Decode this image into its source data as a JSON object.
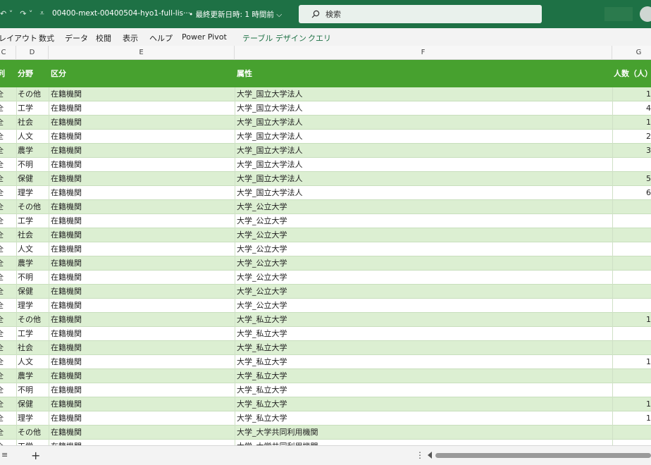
{
  "titlebar": {
    "undo_glyph": "↶ ˅",
    "redo_glyph": "↷ ˅",
    "qat_more": "⩡",
    "doc_title": "00400-mext-00400504-hyo1-full-lis···",
    "status": "• 最終更新日時: 1 時間前 ⌵",
    "search_placeholder": "検索"
  },
  "ribbon": {
    "tabs": [
      "レイアウト",
      "数式",
      "データ",
      "校閲",
      "表示",
      "ヘルプ",
      "Power Pivot",
      "テーブル デザイン",
      "クエリ"
    ]
  },
  "columns": [
    "C",
    "D",
    "E",
    "F",
    "G"
  ],
  "table": {
    "left_stub": "列",
    "headers": {
      "field": "分野",
      "category": "区分",
      "attribute": "属性",
      "count": "人数（人）"
    },
    "rows": [
      {
        "stub": "全",
        "field": "その他",
        "category": "在籍機関",
        "attribute": "大学_国立大学法人",
        "count": "1"
      },
      {
        "stub": "全",
        "field": "工学",
        "category": "在籍機関",
        "attribute": "大学_国立大学法人",
        "count": "4"
      },
      {
        "stub": "全",
        "field": "社会",
        "category": "在籍機関",
        "attribute": "大学_国立大学法人",
        "count": "1"
      },
      {
        "stub": "全",
        "field": "人文",
        "category": "在籍機関",
        "attribute": "大学_国立大学法人",
        "count": "2"
      },
      {
        "stub": "全",
        "field": "農学",
        "category": "在籍機関",
        "attribute": "大学_国立大学法人",
        "count": "3"
      },
      {
        "stub": "全",
        "field": "不明",
        "category": "在籍機関",
        "attribute": "大学_国立大学法人",
        "count": ""
      },
      {
        "stub": "全",
        "field": "保健",
        "category": "在籍機関",
        "attribute": "大学_国立大学法人",
        "count": "5"
      },
      {
        "stub": "全",
        "field": "理学",
        "category": "在籍機関",
        "attribute": "大学_国立大学法人",
        "count": "6"
      },
      {
        "stub": "全",
        "field": "その他",
        "category": "在籍機関",
        "attribute": "大学_公立大学",
        "count": ""
      },
      {
        "stub": "全",
        "field": "工学",
        "category": "在籍機関",
        "attribute": "大学_公立大学",
        "count": ""
      },
      {
        "stub": "全",
        "field": "社会",
        "category": "在籍機関",
        "attribute": "大学_公立大学",
        "count": ""
      },
      {
        "stub": "全",
        "field": "人文",
        "category": "在籍機関",
        "attribute": "大学_公立大学",
        "count": ""
      },
      {
        "stub": "全",
        "field": "農学",
        "category": "在籍機関",
        "attribute": "大学_公立大学",
        "count": ""
      },
      {
        "stub": "全",
        "field": "不明",
        "category": "在籍機関",
        "attribute": "大学_公立大学",
        "count": ""
      },
      {
        "stub": "全",
        "field": "保健",
        "category": "在籍機関",
        "attribute": "大学_公立大学",
        "count": ""
      },
      {
        "stub": "全",
        "field": "理学",
        "category": "在籍機関",
        "attribute": "大学_公立大学",
        "count": ""
      },
      {
        "stub": "全",
        "field": "その他",
        "category": "在籍機関",
        "attribute": "大学_私立大学",
        "count": "1"
      },
      {
        "stub": "全",
        "field": "工学",
        "category": "在籍機関",
        "attribute": "大学_私立大学",
        "count": ""
      },
      {
        "stub": "全",
        "field": "社会",
        "category": "在籍機関",
        "attribute": "大学_私立大学",
        "count": ""
      },
      {
        "stub": "全",
        "field": "人文",
        "category": "在籍機関",
        "attribute": "大学_私立大学",
        "count": "1"
      },
      {
        "stub": "全",
        "field": "農学",
        "category": "在籍機関",
        "attribute": "大学_私立大学",
        "count": ""
      },
      {
        "stub": "全",
        "field": "不明",
        "category": "在籍機関",
        "attribute": "大学_私立大学",
        "count": ""
      },
      {
        "stub": "全",
        "field": "保健",
        "category": "在籍機関",
        "attribute": "大学_私立大学",
        "count": "1"
      },
      {
        "stub": "全",
        "field": "理学",
        "category": "在籍機関",
        "attribute": "大学_私立大学",
        "count": "1"
      },
      {
        "stub": "全",
        "field": "その他",
        "category": "在籍機関",
        "attribute": "大学_大学共同利用機関",
        "count": ""
      },
      {
        "stub": "全",
        "field": "工学",
        "category": "在籍機関",
        "attribute": "大学_大学共同利用機関",
        "count": ""
      }
    ]
  },
  "bottombar": {
    "sheet_mark": "≡",
    "add_sheet": "+",
    "more": "⋮"
  },
  "colors": {
    "title_bar": "#1e7145",
    "table_header": "#47a12f",
    "band_row": "#dcefd2"
  }
}
